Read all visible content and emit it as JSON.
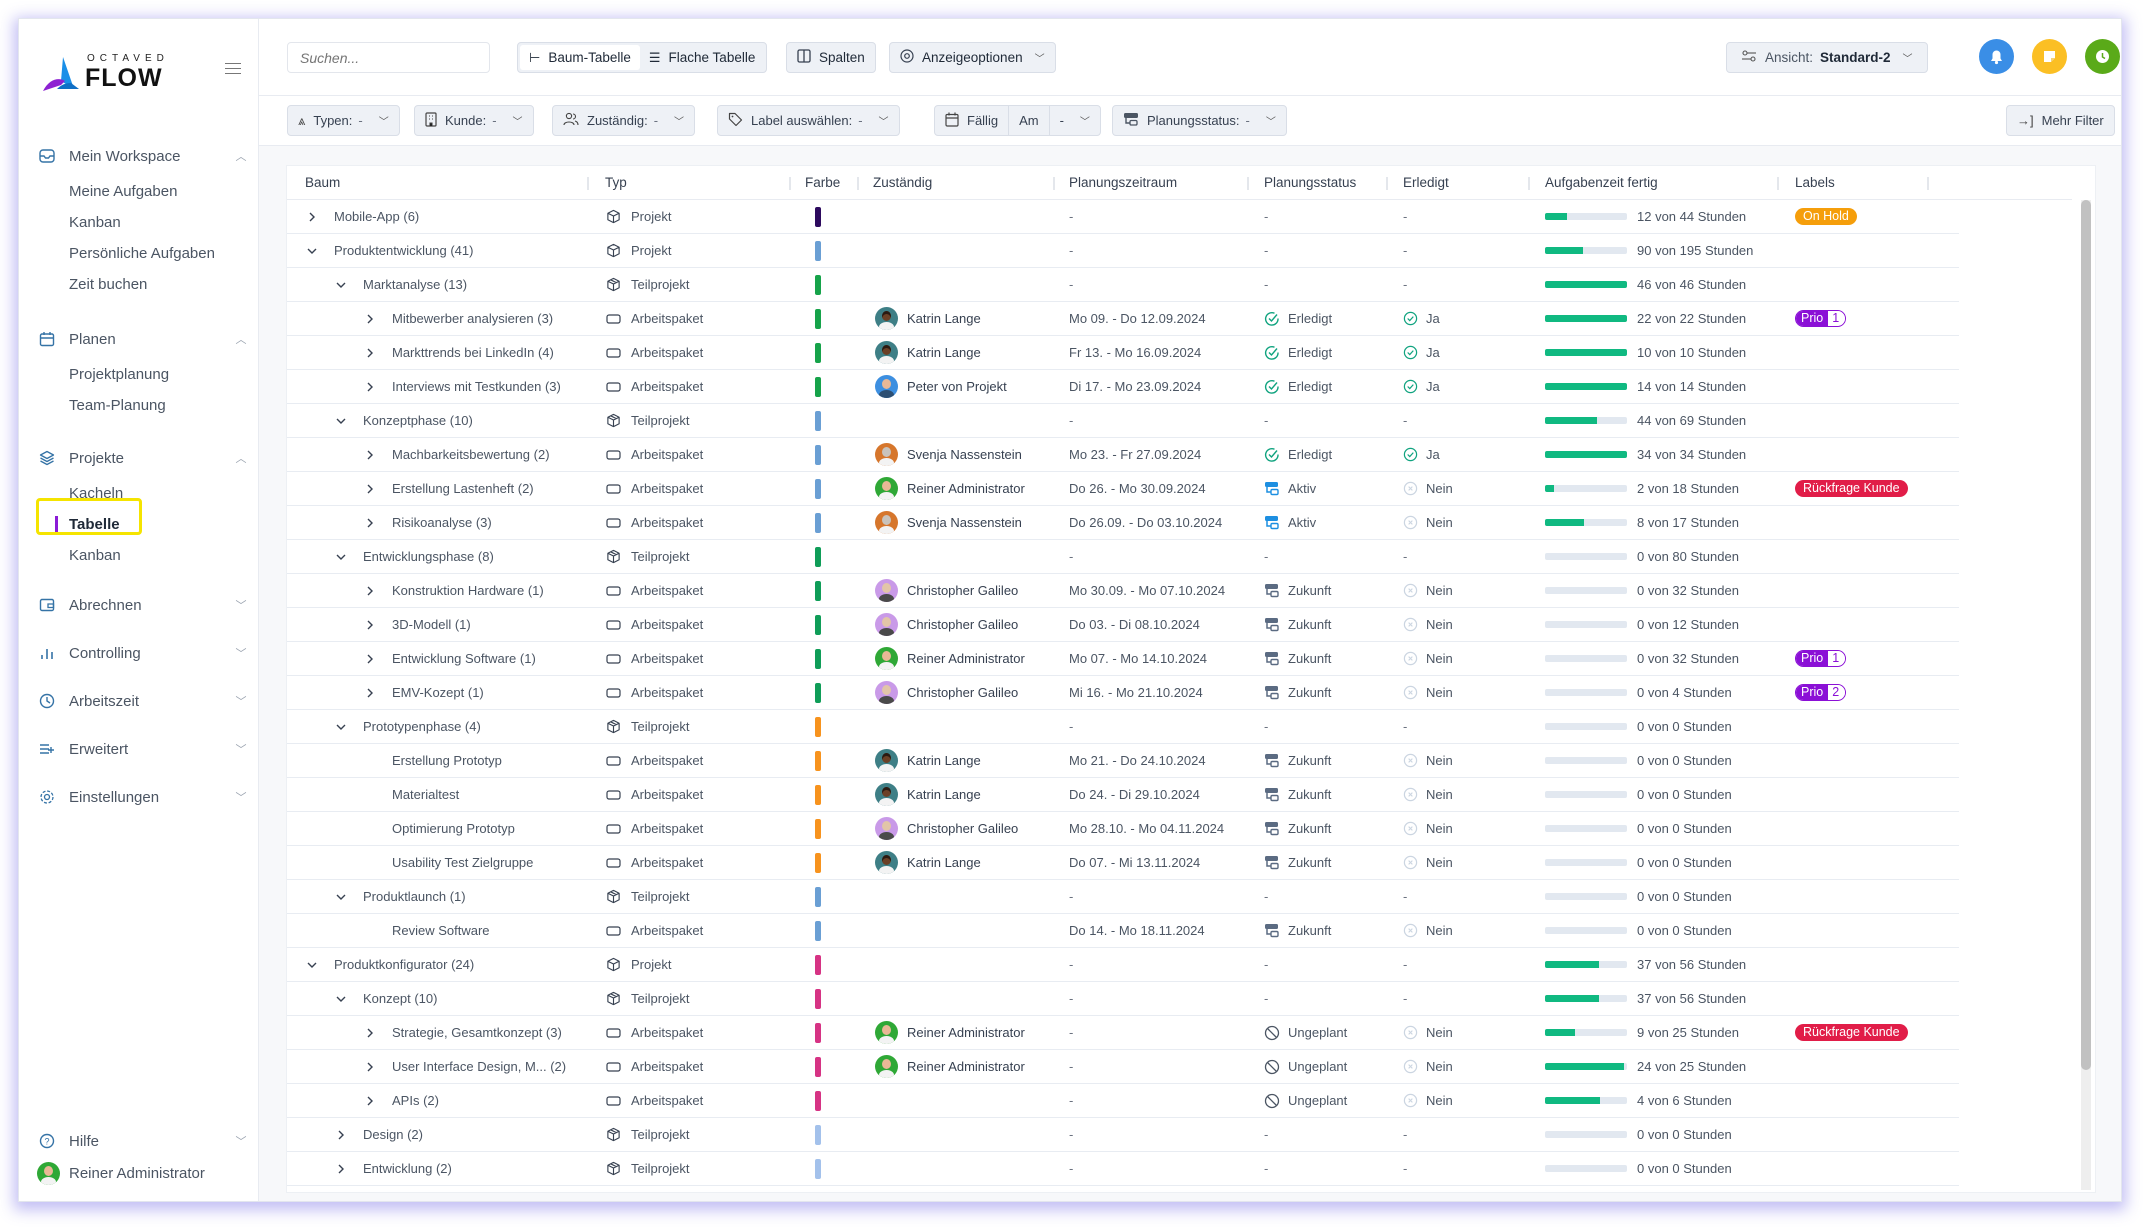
{
  "app": {
    "logo_top": "OCTAVED",
    "logo_main": "FLOW"
  },
  "sidebar": {
    "groups": [
      {
        "label": "Mein Workspace",
        "icon": "inbox-icon",
        "expanded": true,
        "items": [
          "Meine Aufgaben",
          "Kanban",
          "Persönliche Aufgaben",
          "Zeit buchen"
        ]
      },
      {
        "label": "Planen",
        "icon": "calendar-icon",
        "expanded": true,
        "items": [
          "Projektplanung",
          "Team-Planung"
        ]
      },
      {
        "label": "Projekte",
        "icon": "layers-icon",
        "expanded": true,
        "items": [
          "Kacheln",
          "Tabelle",
          "Kanban"
        ],
        "active_item": "Tabelle"
      },
      {
        "label": "Abrechnen",
        "icon": "wallet-icon",
        "expanded": false
      },
      {
        "label": "Controlling",
        "icon": "bar-chart-icon",
        "expanded": false
      },
      {
        "label": "Arbeitszeit",
        "icon": "clock-icon",
        "expanded": false
      },
      {
        "label": "Erweitert",
        "icon": "list-plus-icon",
        "expanded": false
      },
      {
        "label": "Einstellungen",
        "icon": "gear-icon",
        "expanded": false
      },
      {
        "label": "Hilfe",
        "icon": "help-icon",
        "expanded": false
      }
    ],
    "user": "Reiner Administrator"
  },
  "topbar": {
    "search_placeholder": "Suchen...",
    "view_toggle": [
      {
        "label": "Baum-Tabelle",
        "active": true
      },
      {
        "label": "Flache Tabelle",
        "active": false
      }
    ],
    "columns_label": "Spalten",
    "display_options_label": "Anzeigeoptionen",
    "view_label": "Ansicht:",
    "view_value": "Standard-2",
    "action_colors": {
      "notifications": "#3a8ee6",
      "notes": "#fbbf24",
      "timer": "#5aaa19"
    }
  },
  "filters": {
    "typen": {
      "label": "Typen:",
      "value": "-"
    },
    "kunde": {
      "label": "Kunde:",
      "value": "-"
    },
    "zustaendig": {
      "label": "Zuständig:",
      "value": "-"
    },
    "label": {
      "label": "Label auswählen:",
      "value": "-"
    },
    "faellig": {
      "label": "Fällig",
      "mode": "Am",
      "value": "-"
    },
    "planungsstatus": {
      "label": "Planungsstatus:",
      "value": "-"
    },
    "more": "Mehr Filter"
  },
  "table": {
    "columns": [
      "Baum",
      "Typ",
      "Farbe",
      "Zuständig",
      "Planungszeitraum",
      "Planungsstatus",
      "Erledigt",
      "Aufgabenzeit fertig",
      "Labels"
    ],
    "rows": [
      {
        "level": 0,
        "toggle": "collapsed",
        "name": "Mobile-App (6)",
        "type": "Projekt",
        "color": "#2d0a5e",
        "assignee": "",
        "period": "-",
        "status": "-",
        "done": "-",
        "done_h": 12,
        "total_h": 44,
        "time": "12 von 44 Stunden",
        "label": {
          "kind": "pill",
          "text": "On Hold",
          "color": "#f59e0b"
        }
      },
      {
        "level": 0,
        "toggle": "expanded",
        "name": "Produktentwicklung (41)",
        "type": "Projekt",
        "color": "#6a9fd4",
        "assignee": "",
        "period": "-",
        "status": "-",
        "done": "-",
        "done_h": 90,
        "total_h": 195,
        "time": "90 von 195 Stunden"
      },
      {
        "level": 1,
        "toggle": "expanded",
        "name": "Marktanalyse (13)",
        "type": "Teilprojekt",
        "color": "#16a34a",
        "assignee": "",
        "period": "-",
        "status": "-",
        "done": "-",
        "done_h": 46,
        "total_h": 46,
        "time": "46 von 46 Stunden"
      },
      {
        "level": 2,
        "toggle": "collapsed",
        "name": "Mitbewerber analysieren (3)",
        "type": "Arbeitspaket",
        "color": "#16a34a",
        "assignee": "Katrin Lange",
        "avatar": "teal",
        "period": "Mo 09. - Do 12.09.2024",
        "status": "Erledigt",
        "done": "Ja",
        "done_h": 22,
        "total_h": 22,
        "time": "22 von 22 Stunden",
        "label": {
          "kind": "prio",
          "text": "Prio",
          "num": "1"
        }
      },
      {
        "level": 2,
        "toggle": "collapsed",
        "name": "Markttrends bei LinkedIn (4)",
        "type": "Arbeitspaket",
        "color": "#16a34a",
        "assignee": "Katrin Lange",
        "avatar": "teal",
        "period": "Fr 13. - Mo 16.09.2024",
        "status": "Erledigt",
        "done": "Ja",
        "done_h": 10,
        "total_h": 10,
        "time": "10 von 10 Stunden"
      },
      {
        "level": 2,
        "toggle": "collapsed",
        "name": "Interviews mit Testkunden (3)",
        "type": "Arbeitspaket",
        "color": "#16a34a",
        "assignee": "Peter von Projekt",
        "avatar": "blue",
        "period": "Di 17. - Mo 23.09.2024",
        "status": "Erledigt",
        "done": "Ja",
        "done_h": 14,
        "total_h": 14,
        "time": "14 von 14 Stunden"
      },
      {
        "level": 1,
        "toggle": "expanded",
        "name": "Konzeptphase (10)",
        "type": "Teilprojekt",
        "color": "#6a9fd4",
        "assignee": "",
        "period": "-",
        "status": "-",
        "done": "-",
        "done_h": 44,
        "total_h": 69,
        "time": "44 von 69 Stunden"
      },
      {
        "level": 2,
        "toggle": "collapsed",
        "name": "Machbarkeitsbewertung (2)",
        "type": "Arbeitspaket",
        "color": "#6a9fd4",
        "assignee": "Svenja Nassenstein",
        "avatar": "orange",
        "period": "Mo 23. - Fr 27.09.2024",
        "status": "Erledigt",
        "done": "Ja",
        "done_h": 34,
        "total_h": 34,
        "time": "34 von 34 Stunden"
      },
      {
        "level": 2,
        "toggle": "collapsed",
        "name": "Erstellung Lastenheft (2)",
        "type": "Arbeitspaket",
        "color": "#6a9fd4",
        "assignee": "Reiner Administrator",
        "avatar": "green",
        "period": "Do 26. - Mo 30.09.2024",
        "status": "Aktiv",
        "done": "Nein",
        "done_h": 2,
        "total_h": 18,
        "time": "2 von 18 Stunden",
        "label": {
          "kind": "pill",
          "text": "Rückfrage Kunde",
          "color": "#e11d48"
        }
      },
      {
        "level": 2,
        "toggle": "collapsed",
        "name": "Risikoanalyse (3)",
        "type": "Arbeitspaket",
        "color": "#6a9fd4",
        "assignee": "Svenja Nassenstein",
        "avatar": "orange",
        "period": "Do 26.09. - Do 03.10.2024",
        "status": "Aktiv",
        "done": "Nein",
        "done_h": 8,
        "total_h": 17,
        "time": "8 von 17 Stunden"
      },
      {
        "level": 1,
        "toggle": "expanded",
        "name": "Entwicklungsphase (8)",
        "type": "Teilprojekt",
        "color": "#0f9d58",
        "assignee": "",
        "period": "-",
        "status": "-",
        "done": "-",
        "done_h": 0,
        "total_h": 80,
        "time": "0 von 80 Stunden"
      },
      {
        "level": 2,
        "toggle": "collapsed",
        "name": "Konstruktion Hardware (1)",
        "type": "Arbeitspaket",
        "color": "#0f9d58",
        "assignee": "Christopher Galileo",
        "avatar": "purple",
        "period": "Mo 30.09. - Mo 07.10.2024",
        "status": "Zukunft",
        "done": "Nein",
        "done_h": 0,
        "total_h": 32,
        "time": "0 von 32 Stunden"
      },
      {
        "level": 2,
        "toggle": "collapsed",
        "name": "3D-Modell (1)",
        "type": "Arbeitspaket",
        "color": "#0f9d58",
        "assignee": "Christopher Galileo",
        "avatar": "purple",
        "period": "Do 03. - Di 08.10.2024",
        "status": "Zukunft",
        "done": "Nein",
        "done_h": 0,
        "total_h": 12,
        "time": "0 von 12 Stunden"
      },
      {
        "level": 2,
        "toggle": "collapsed",
        "name": "Entwicklung Software (1)",
        "type": "Arbeitspaket",
        "color": "#0f9d58",
        "assignee": "Reiner Administrator",
        "avatar": "green",
        "period": "Mo 07. - Mo 14.10.2024",
        "status": "Zukunft",
        "done": "Nein",
        "done_h": 0,
        "total_h": 32,
        "time": "0 von 32 Stunden",
        "label": {
          "kind": "prio",
          "text": "Prio",
          "num": "1"
        }
      },
      {
        "level": 2,
        "toggle": "collapsed",
        "name": "EMV-Kozept (1)",
        "type": "Arbeitspaket",
        "color": "#0f9d58",
        "assignee": "Christopher Galileo",
        "avatar": "purple",
        "period": "Mi 16. - Mo 21.10.2024",
        "status": "Zukunft",
        "done": "Nein",
        "done_h": 0,
        "total_h": 4,
        "time": "0 von 4 Stunden",
        "label": {
          "kind": "prio",
          "text": "Prio",
          "num": "2"
        }
      },
      {
        "level": 1,
        "toggle": "expanded",
        "name": "Prototypenphase (4)",
        "type": "Teilprojekt",
        "color": "#f7931e",
        "assignee": "",
        "period": "-",
        "status": "-",
        "done": "-",
        "done_h": 0,
        "total_h": 0,
        "time": "0 von 0 Stunden"
      },
      {
        "level": 2,
        "toggle": "none",
        "name": "Erstellung Prototyp",
        "type": "Arbeitspaket",
        "color": "#f7931e",
        "assignee": "Katrin Lange",
        "avatar": "teal",
        "period": "Mo 21. - Do 24.10.2024",
        "status": "Zukunft",
        "done": "Nein",
        "done_h": 0,
        "total_h": 0,
        "time": "0 von 0 Stunden"
      },
      {
        "level": 2,
        "toggle": "none",
        "name": "Materialtest",
        "type": "Arbeitspaket",
        "color": "#f7931e",
        "assignee": "Katrin Lange",
        "avatar": "teal",
        "period": "Do 24. - Di 29.10.2024",
        "status": "Zukunft",
        "done": "Nein",
        "done_h": 0,
        "total_h": 0,
        "time": "0 von 0 Stunden"
      },
      {
        "level": 2,
        "toggle": "none",
        "name": "Optimierung Prototyp",
        "type": "Arbeitspaket",
        "color": "#f7931e",
        "assignee": "Christopher Galileo",
        "avatar": "purple",
        "period": "Mo 28.10. - Mo 04.11.2024",
        "status": "Zukunft",
        "done": "Nein",
        "done_h": 0,
        "total_h": 0,
        "time": "0 von 0 Stunden"
      },
      {
        "level": 2,
        "toggle": "none",
        "name": "Usability Test Zielgruppe",
        "type": "Arbeitspaket",
        "color": "#f7931e",
        "assignee": "Katrin Lange",
        "avatar": "teal",
        "period": "Do 07. - Mi 13.11.2024",
        "status": "Zukunft",
        "done": "Nein",
        "done_h": 0,
        "total_h": 0,
        "time": "0 von 0 Stunden"
      },
      {
        "level": 1,
        "toggle": "expanded",
        "name": "Produktlaunch (1)",
        "type": "Teilprojekt",
        "color": "#6a9fd4",
        "assignee": "",
        "period": "-",
        "status": "-",
        "done": "-",
        "done_h": 0,
        "total_h": 0,
        "time": "0 von 0 Stunden"
      },
      {
        "level": 2,
        "toggle": "none",
        "name": "Review Software",
        "type": "Arbeitspaket",
        "color": "#6a9fd4",
        "assignee": "",
        "period": "Do 14. - Mo 18.11.2024",
        "status": "Zukunft",
        "done": "Nein",
        "done_h": 0,
        "total_h": 0,
        "time": "0 von 0 Stunden"
      },
      {
        "level": 0,
        "toggle": "expanded",
        "name": "Produktkonfigurator (24)",
        "type": "Projekt",
        "color": "#d63384",
        "assignee": "",
        "period": "-",
        "status": "-",
        "done": "-",
        "done_h": 37,
        "total_h": 56,
        "time": "37 von 56 Stunden"
      },
      {
        "level": 1,
        "toggle": "expanded",
        "name": "Konzept (10)",
        "type": "Teilprojekt",
        "color": "#d63384",
        "assignee": "",
        "period": "-",
        "status": "-",
        "done": "-",
        "done_h": 37,
        "total_h": 56,
        "time": "37 von 56 Stunden"
      },
      {
        "level": 2,
        "toggle": "collapsed",
        "name": "Strategie, Gesamtkonzept (3)",
        "type": "Arbeitspaket",
        "color": "#d63384",
        "assignee": "Reiner Administrator",
        "avatar": "green",
        "period": "-",
        "status": "Ungeplant",
        "done": "Nein",
        "done_h": 9,
        "total_h": 25,
        "time": "9 von 25 Stunden",
        "label": {
          "kind": "pill",
          "text": "Rückfrage Kunde",
          "color": "#e11d48"
        }
      },
      {
        "level": 2,
        "toggle": "collapsed",
        "name": "User Interface Design, M...  (2)",
        "type": "Arbeitspaket",
        "color": "#d63384",
        "assignee": "Reiner Administrator",
        "avatar": "green",
        "period": "-",
        "status": "Ungeplant",
        "done": "Nein",
        "done_h": 24,
        "total_h": 25,
        "time": "24 von 25 Stunden"
      },
      {
        "level": 2,
        "toggle": "collapsed",
        "name": "APIs (2)",
        "type": "Arbeitspaket",
        "color": "#d63384",
        "assignee": "",
        "period": "-",
        "status": "Ungeplant",
        "done": "Nein",
        "done_h": 4,
        "total_h": 6,
        "time": "4 von 6 Stunden"
      },
      {
        "level": 1,
        "toggle": "collapsed",
        "name": "Design (2)",
        "type": "Teilprojekt",
        "color": "#a3c1eb",
        "assignee": "",
        "period": "-",
        "status": "-",
        "done": "-",
        "done_h": 0,
        "total_h": 0,
        "time": "0 von 0 Stunden"
      },
      {
        "level": 1,
        "toggle": "collapsed",
        "name": "Entwicklung (2)",
        "type": "Teilprojekt",
        "color": "#a3c1eb",
        "assignee": "",
        "period": "-",
        "status": "-",
        "done": "-",
        "done_h": 0,
        "total_h": 0,
        "time": "0 von 0 Stunden"
      }
    ]
  }
}
